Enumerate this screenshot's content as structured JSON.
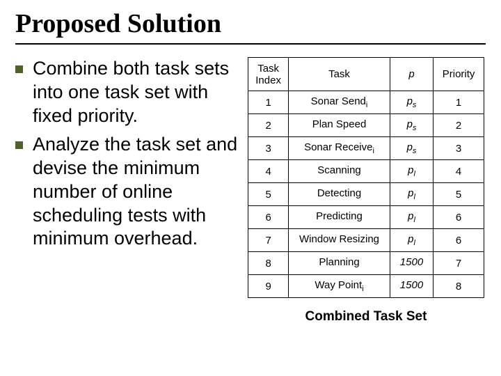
{
  "title": "Proposed Solution",
  "bullets": [
    "Combine both task sets into one task set with fixed priority.",
    "Analyze the task set and devise the minimum number of online scheduling tests with minimum overhead."
  ],
  "table": {
    "headers": {
      "index": "Task Index",
      "task": "Task",
      "p": "p",
      "priority": "Priority"
    },
    "rows": [
      {
        "index": "1",
        "task": "Sonar Send",
        "task_sub": "i",
        "p_base": "p",
        "p_sub": "s",
        "p_plain": "",
        "priority": "1"
      },
      {
        "index": "2",
        "task": "Plan Speed",
        "task_sub": "",
        "p_base": "p",
        "p_sub": "s",
        "p_plain": "",
        "priority": "2"
      },
      {
        "index": "3",
        "task": "Sonar Receive",
        "task_sub": "i",
        "p_base": "p",
        "p_sub": "s",
        "p_plain": "",
        "priority": "3"
      },
      {
        "index": "4",
        "task": "Scanning",
        "task_sub": "",
        "p_base": "p",
        "p_sub": "l",
        "p_plain": "",
        "priority": "4"
      },
      {
        "index": "5",
        "task": "Detecting",
        "task_sub": "",
        "p_base": "p",
        "p_sub": "l",
        "p_plain": "",
        "priority": "5"
      },
      {
        "index": "6",
        "task": "Predicting",
        "task_sub": "",
        "p_base": "p",
        "p_sub": "l",
        "p_plain": "",
        "priority": "6"
      },
      {
        "index": "7",
        "task": "Window Resizing",
        "task_sub": "",
        "p_base": "p",
        "p_sub": "l",
        "p_plain": "",
        "priority": "6"
      },
      {
        "index": "8",
        "task": "Planning",
        "task_sub": "",
        "p_base": "",
        "p_sub": "",
        "p_plain": "1500",
        "priority": "7"
      },
      {
        "index": "9",
        "task": "Way Point",
        "task_sub": "i",
        "p_base": "",
        "p_sub": "",
        "p_plain": "1500",
        "priority": "8"
      }
    ],
    "caption": "Combined Task Set"
  },
  "chart_data": {
    "type": "table",
    "title": "Combined Task Set",
    "columns": [
      "Task Index",
      "Task",
      "p",
      "Priority"
    ],
    "rows": [
      [
        1,
        "Sonar Send_i",
        "p_s",
        1
      ],
      [
        2,
        "Plan Speed",
        "p_s",
        2
      ],
      [
        3,
        "Sonar Receive_i",
        "p_s",
        3
      ],
      [
        4,
        "Scanning",
        "p_l",
        4
      ],
      [
        5,
        "Detecting",
        "p_l",
        5
      ],
      [
        6,
        "Predicting",
        "p_l",
        6
      ],
      [
        7,
        "Window Resizing",
        "p_l",
        6
      ],
      [
        8,
        "Planning",
        1500,
        7
      ],
      [
        9,
        "Way Point_i",
        1500,
        8
      ]
    ]
  }
}
